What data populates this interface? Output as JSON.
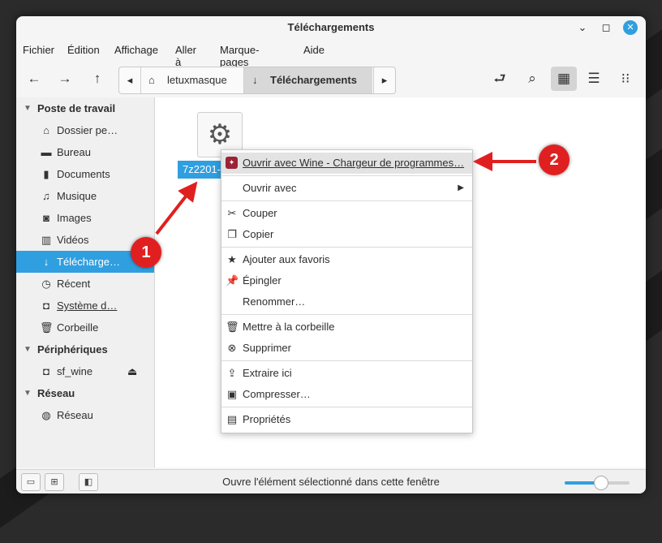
{
  "window": {
    "title": "Téléchargements"
  },
  "menubar": [
    "Fichier",
    "Édition",
    "Affichage",
    "Aller à",
    "Marque-pages",
    "Aide"
  ],
  "pathbar": {
    "crumbs": [
      "letuxmasque",
      "Téléchargements"
    ]
  },
  "sidebar": {
    "sections": [
      {
        "label": "Poste de travail"
      },
      {
        "label": "Périphériques"
      },
      {
        "label": "Réseau"
      }
    ],
    "items": [
      {
        "label": "Dossier pe…"
      },
      {
        "label": "Bureau"
      },
      {
        "label": "Documents"
      },
      {
        "label": "Musique"
      },
      {
        "label": "Images"
      },
      {
        "label": "Vidéos"
      },
      {
        "label": "Télécharge…"
      },
      {
        "label": "Récent"
      },
      {
        "label": "Système d…"
      },
      {
        "label": "Corbeille"
      },
      {
        "label": "sf_wine"
      },
      {
        "label": "Réseau"
      }
    ]
  },
  "content": {
    "file_label": "7z2201-"
  },
  "context_menu": {
    "items": [
      {
        "label": "Ouvrir avec Wine - Chargeur de programmes…",
        "icon": "wine-icon"
      },
      {
        "label": "Ouvrir avec",
        "icon": "none"
      },
      {
        "label": "Couper",
        "icon": "scissors-icon"
      },
      {
        "label": "Copier",
        "icon": "copy-icon"
      },
      {
        "label": "Ajouter aux favoris",
        "icon": "star-icon"
      },
      {
        "label": "Épingler",
        "icon": "pin-icon"
      },
      {
        "label": "Renommer…",
        "icon": "none"
      },
      {
        "label": "Mettre à la corbeille",
        "icon": "trash-icon"
      },
      {
        "label": "Supprimer",
        "icon": "delete-icon"
      },
      {
        "label": "Extraire ici",
        "icon": "extract-icon"
      },
      {
        "label": "Compresser…",
        "icon": "archive-icon"
      },
      {
        "label": "Propriétés",
        "icon": "properties-icon"
      }
    ]
  },
  "annotations": {
    "badge1": "1",
    "badge2": "2"
  },
  "statusbar": {
    "text": "Ouvre l'élément sélectionné dans cette fenêtre",
    "zoom_level": 0.55
  },
  "colors": {
    "accent": "#2f9fe0",
    "annotation": "#e02020"
  }
}
